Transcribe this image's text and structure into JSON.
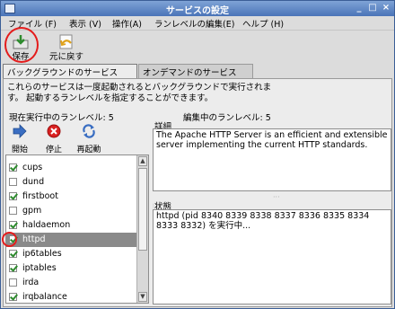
{
  "window": {
    "title": "サービスの設定",
    "buttons": [
      "_",
      "□",
      "×"
    ]
  },
  "menubar": [
    "ファイル (F)",
    "表示 (V)",
    "操作(A)",
    "ランレベルの編集(E)",
    "ヘルプ (H)"
  ],
  "toolbar": {
    "save_label": "保存",
    "revert_label": "元に戻す"
  },
  "tabs": {
    "background": "バックグラウンドのサービス (B)",
    "ondemand": "オンデマンドのサービス(O)"
  },
  "panel": {
    "description": "これらのサービスは一度起動されるとバックグラウンドで実行されます。 起動するランレベルを指定することができます。",
    "current_runlevel": "現在実行中のランレベル: 5",
    "edit_runlevel": "編集中のランレベル: 5"
  },
  "actions": {
    "start": "開始",
    "stop": "停止",
    "restart": "再起動"
  },
  "services": [
    {
      "name": "cups",
      "checked": true
    },
    {
      "name": "dund",
      "checked": false
    },
    {
      "name": "firstboot",
      "checked": true
    },
    {
      "name": "gpm",
      "checked": false
    },
    {
      "name": "haldaemon",
      "checked": true
    },
    {
      "name": "httpd",
      "checked": true,
      "selected": true
    },
    {
      "name": "ip6tables",
      "checked": true
    },
    {
      "name": "iptables",
      "checked": true
    },
    {
      "name": "irda",
      "checked": false
    },
    {
      "name": "irqbalance",
      "checked": true
    }
  ],
  "details": {
    "label": "詳細",
    "text": "The Apache HTTP Server is an efficient and extensible server implementing the current HTTP standards."
  },
  "status": {
    "label": "状態",
    "text": "httpd (pid 8340 8339 8338 8337 8336 8335 8334 8333 8332) を実行中..."
  }
}
